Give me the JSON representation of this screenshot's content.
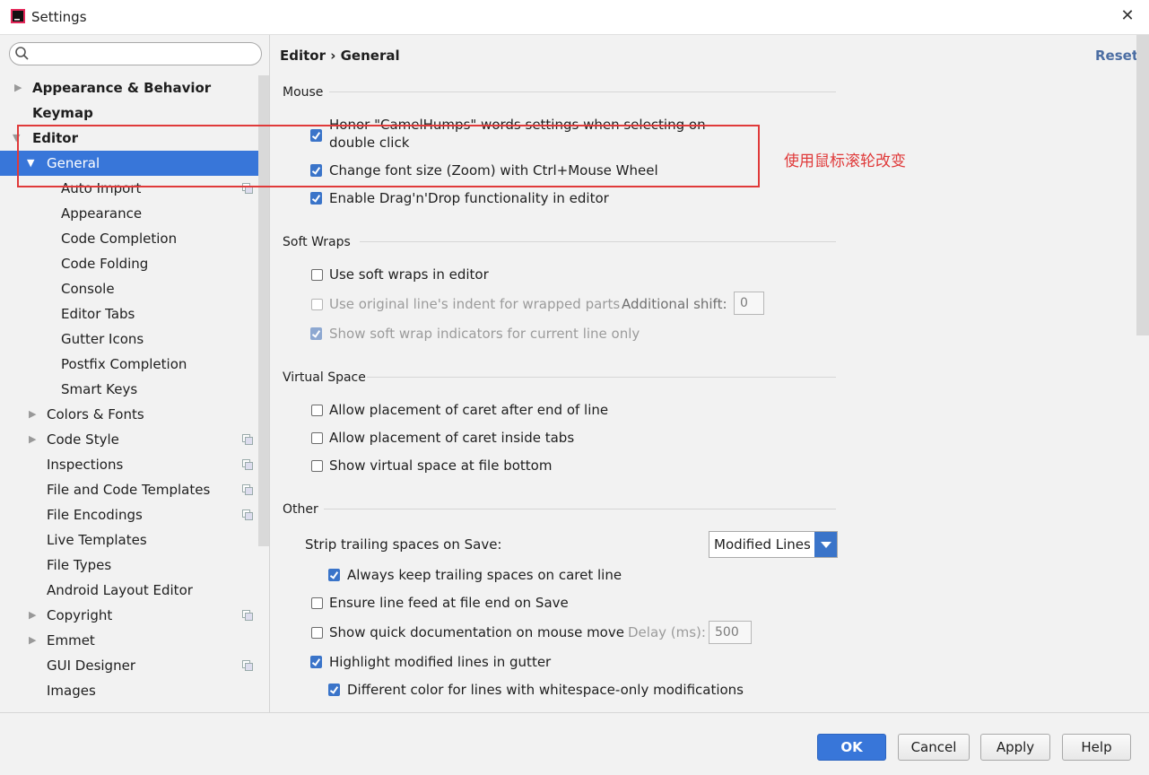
{
  "window": {
    "title": "Settings"
  },
  "search": {
    "placeholder": ""
  },
  "sidebar": {
    "items": [
      {
        "label": "Appearance & Behavior"
      },
      {
        "label": "Keymap"
      },
      {
        "label": "Editor"
      },
      {
        "label": "General"
      },
      {
        "label": "Auto Import"
      },
      {
        "label": "Appearance"
      },
      {
        "label": "Code Completion"
      },
      {
        "label": "Code Folding"
      },
      {
        "label": "Console"
      },
      {
        "label": "Editor Tabs"
      },
      {
        "label": "Gutter Icons"
      },
      {
        "label": "Postfix Completion"
      },
      {
        "label": "Smart Keys"
      },
      {
        "label": "Colors & Fonts"
      },
      {
        "label": "Code Style"
      },
      {
        "label": "Inspections"
      },
      {
        "label": "File and Code Templates"
      },
      {
        "label": "File Encodings"
      },
      {
        "label": "Live Templates"
      },
      {
        "label": "File Types"
      },
      {
        "label": "Android Layout Editor"
      },
      {
        "label": "Copyright"
      },
      {
        "label": "Emmet"
      },
      {
        "label": "GUI Designer"
      },
      {
        "label": "Images"
      }
    ]
  },
  "header": {
    "breadcrumb": "Editor › General",
    "reset": "Reset"
  },
  "mouse": {
    "title": "Mouse",
    "camel_line1": "Honor \"CamelHumps\" words settings when selecting on",
    "camel_line2": "double click",
    "zoom": "Change font size (Zoom) with Ctrl+Mouse Wheel",
    "dnd": "Enable Drag'n'Drop functionality in editor"
  },
  "soft_wraps": {
    "title": "Soft Wraps",
    "use": "Use soft wraps in editor",
    "indent": "Use original line's indent for wrapped parts",
    "shift_label": "Additional shift:",
    "shift_value": "0",
    "indicators": "Show soft wrap indicators for current line only"
  },
  "virtual_space": {
    "title": "Virtual Space",
    "after_end": "Allow placement of caret after end of line",
    "inside_tabs": "Allow placement of caret inside tabs",
    "file_bottom": "Show virtual space at file bottom"
  },
  "other": {
    "title": "Other",
    "strip_label": "Strip trailing spaces on Save:",
    "strip_value": "Modified Lines",
    "keep_trailing": "Always keep trailing spaces on caret line",
    "line_feed": "Ensure line feed at file end on Save",
    "quick_doc": "Show quick documentation on mouse move",
    "delay_label": "Delay (ms):",
    "delay_value": "500",
    "highlight": "Highlight modified lines in gutter",
    "whitespace": "Different color for lines with whitespace-only modifications"
  },
  "annotation": {
    "text": "使用鼠标滚轮改变"
  },
  "buttons": {
    "ok": "OK",
    "cancel": "Cancel",
    "apply": "Apply",
    "help": "Help"
  },
  "colors": {
    "accent": "#3876d9",
    "annotation": "#e03a3a",
    "reset_link": "#4c6ea3"
  }
}
